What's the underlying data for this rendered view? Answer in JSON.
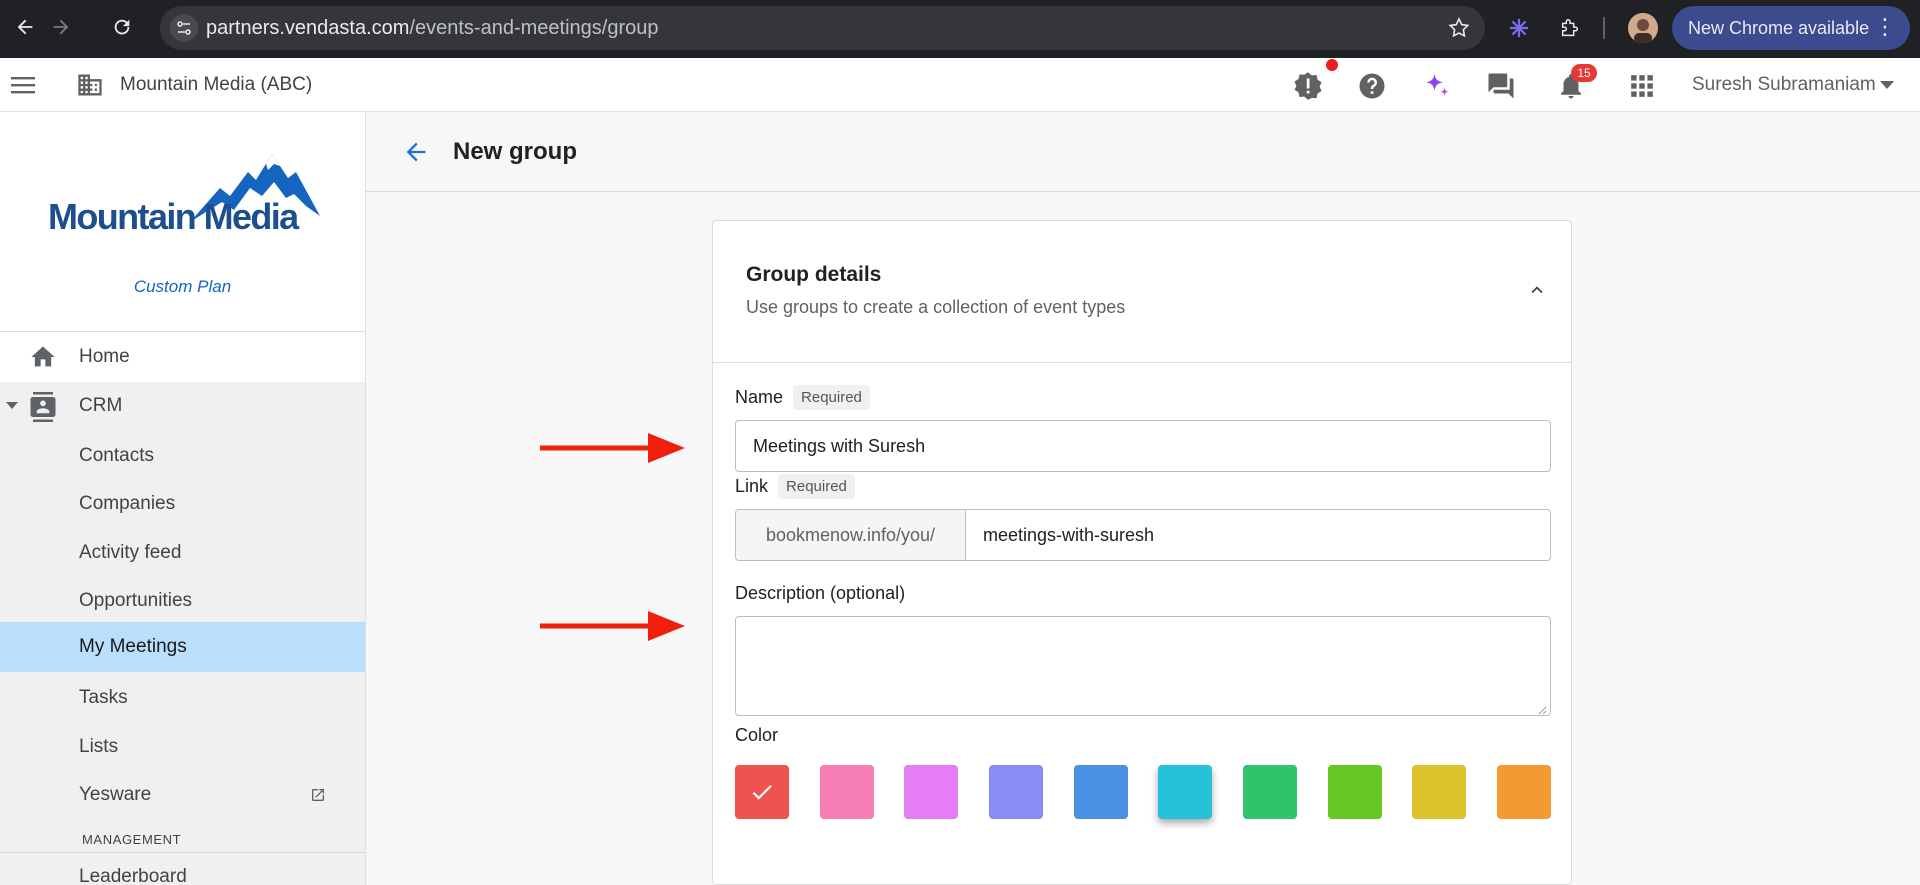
{
  "browser": {
    "url_host": "partners.vendasta.com",
    "url_path": "/events-and-meetings/group",
    "update_label": "New Chrome available"
  },
  "appbar": {
    "company": "Mountain Media (ABC)",
    "notification_count": "15",
    "user_name": "Suresh Subramaniam"
  },
  "sidebar": {
    "logo_text": "Mountain Media",
    "plan": "Custom Plan",
    "items": [
      {
        "label": "Home",
        "icon": "home-icon"
      },
      {
        "label": "CRM",
        "icon": "contacts-book-icon"
      },
      {
        "label": "Contacts"
      },
      {
        "label": "Companies"
      },
      {
        "label": "Activity feed"
      },
      {
        "label": "Opportunities"
      },
      {
        "label": "My Meetings",
        "active": true
      },
      {
        "label": "Tasks"
      },
      {
        "label": "Lists"
      },
      {
        "label": "Yesware",
        "icon": "external-link-icon"
      }
    ],
    "section_label": "MANAGEMENT",
    "next_item": "Leaderboard"
  },
  "page": {
    "title": "New group"
  },
  "card": {
    "title": "Group details",
    "subtitle": "Use groups to create a collection of event types",
    "name_label": "Name",
    "required_tag": "Required",
    "name_value": "Meetings with Suresh",
    "link_label": "Link",
    "link_prefix": "bookmenow.info/you/",
    "link_value": "meetings-with-suresh",
    "description_label": "Description (optional)",
    "description_value": "",
    "color_label": "Color",
    "colors": [
      "#ef5350",
      "#f67fb5",
      "#e57ef5",
      "#8c8cf7",
      "#4a90e2",
      "#26c2d9",
      "#2fc46c",
      "#66c724",
      "#dcc22b",
      "#f39a33"
    ],
    "selected_color_index": 0,
    "hovered_color_index": 5
  },
  "annotations": {
    "arrow_color": "#f0200e"
  }
}
